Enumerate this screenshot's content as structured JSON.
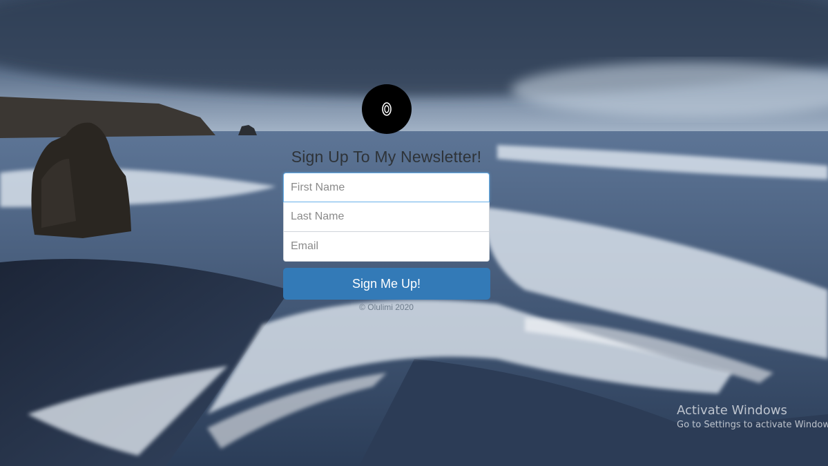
{
  "signup": {
    "heading": "Sign Up To My Newsletter!",
    "logo_icon": "ring-logo-icon",
    "first_name_placeholder": "First Name",
    "last_name_placeholder": "Last Name",
    "email_placeholder": "Email",
    "submit_label": "Sign Me Up!",
    "copyright": "© Olulimi 2020"
  },
  "windows_watermark": {
    "title": "Activate Windows",
    "subtitle": "Go to Settings to activate Windows."
  },
  "colors": {
    "button": "#337ab7",
    "focus_border": "#66afe9",
    "logo_bg": "#000000"
  }
}
